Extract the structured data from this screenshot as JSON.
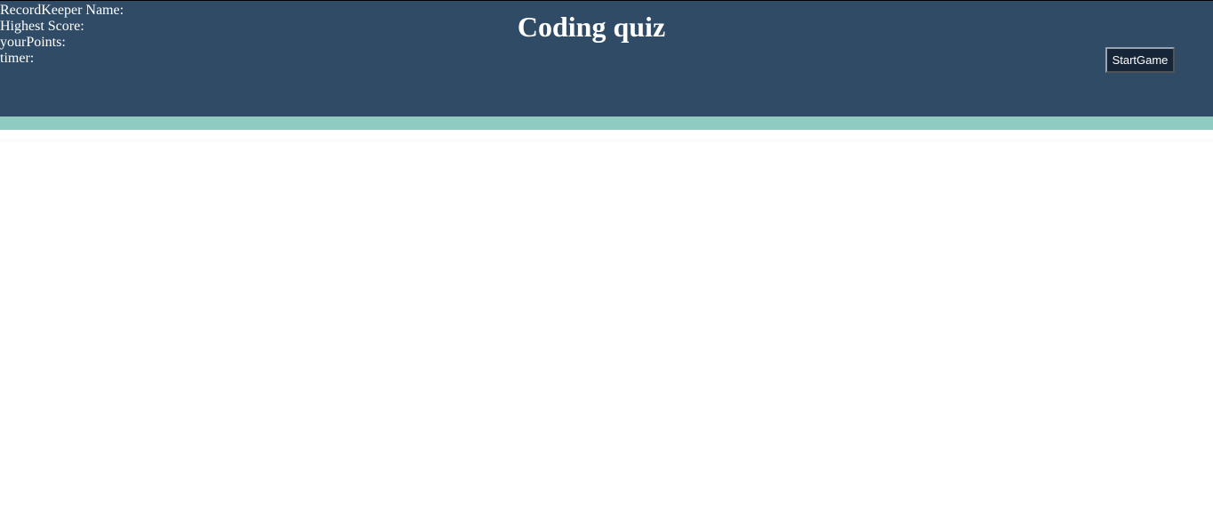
{
  "header": {
    "title": "Coding quiz",
    "stats": {
      "record_keeper_label": "RecordKeeper Name:",
      "highest_score_label": "Highest Score:",
      "your_points_label": "yourPoints:",
      "timer_label": "timer:"
    },
    "start_button_label": "StartGame"
  },
  "colors": {
    "header_bg": "#2f4b66",
    "stripe": "#8fcbbf",
    "button_bg": "#172538",
    "text": "#ffffff"
  }
}
